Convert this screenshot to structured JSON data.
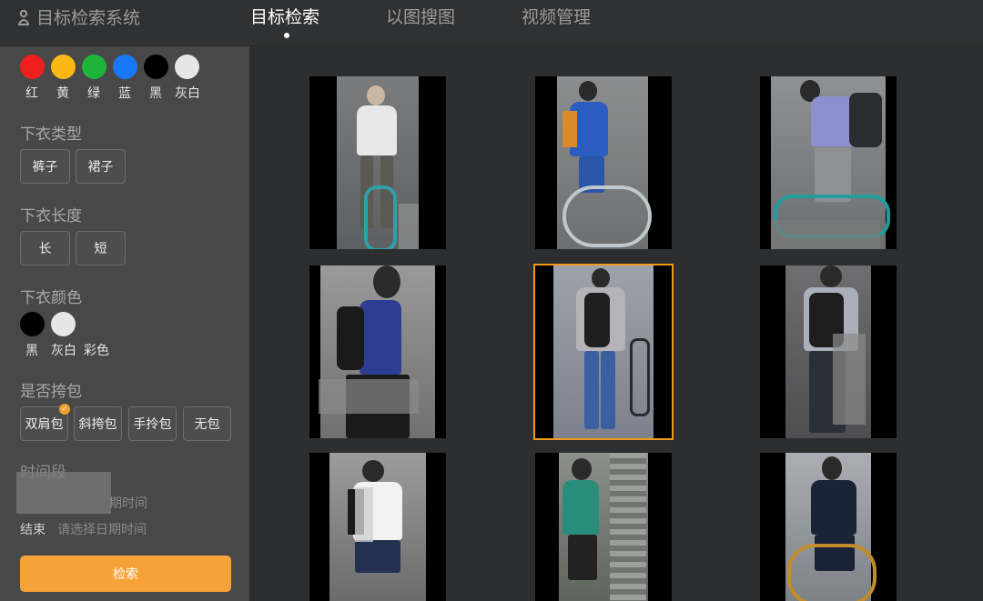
{
  "app": {
    "title": "目标检索系统"
  },
  "nav": {
    "items": [
      "目标检索",
      "以图搜图",
      "视频管理"
    ]
  },
  "filters": {
    "top_colors": [
      {
        "label": "红",
        "color": "#f01f1f"
      },
      {
        "label": "黄",
        "color": "#fbb714"
      },
      {
        "label": "绿",
        "color": "#1fb53b"
      },
      {
        "label": "蓝",
        "color": "#1878f6"
      },
      {
        "label": "黑",
        "color": "#000000"
      },
      {
        "label": "灰白",
        "color": "#e6e6e6"
      }
    ],
    "bottom_type": {
      "title": "下衣类型",
      "options": [
        "裤子",
        "裙子"
      ]
    },
    "bottom_length": {
      "title": "下衣长度",
      "options": [
        "长",
        "短"
      ]
    },
    "bottom_color": {
      "title": "下衣颜色",
      "options": [
        {
          "label": "黑",
          "color": "#000000"
        },
        {
          "label": "灰白",
          "color": "#e6e6e6"
        },
        {
          "label": "彩色",
          "color": ""
        }
      ]
    },
    "bag": {
      "title": "是否挎包",
      "options": [
        "双肩包",
        "斜挎包",
        "手拎包",
        "无包"
      ],
      "selected": "双肩包"
    },
    "time": {
      "title": "时间段",
      "start_placeholder_tail": "期时间",
      "end_label": "结束",
      "end_placeholder": "请选择日期时间"
    },
    "search_button": "检索"
  },
  "results": {
    "count": 9,
    "selected_index": 4
  }
}
